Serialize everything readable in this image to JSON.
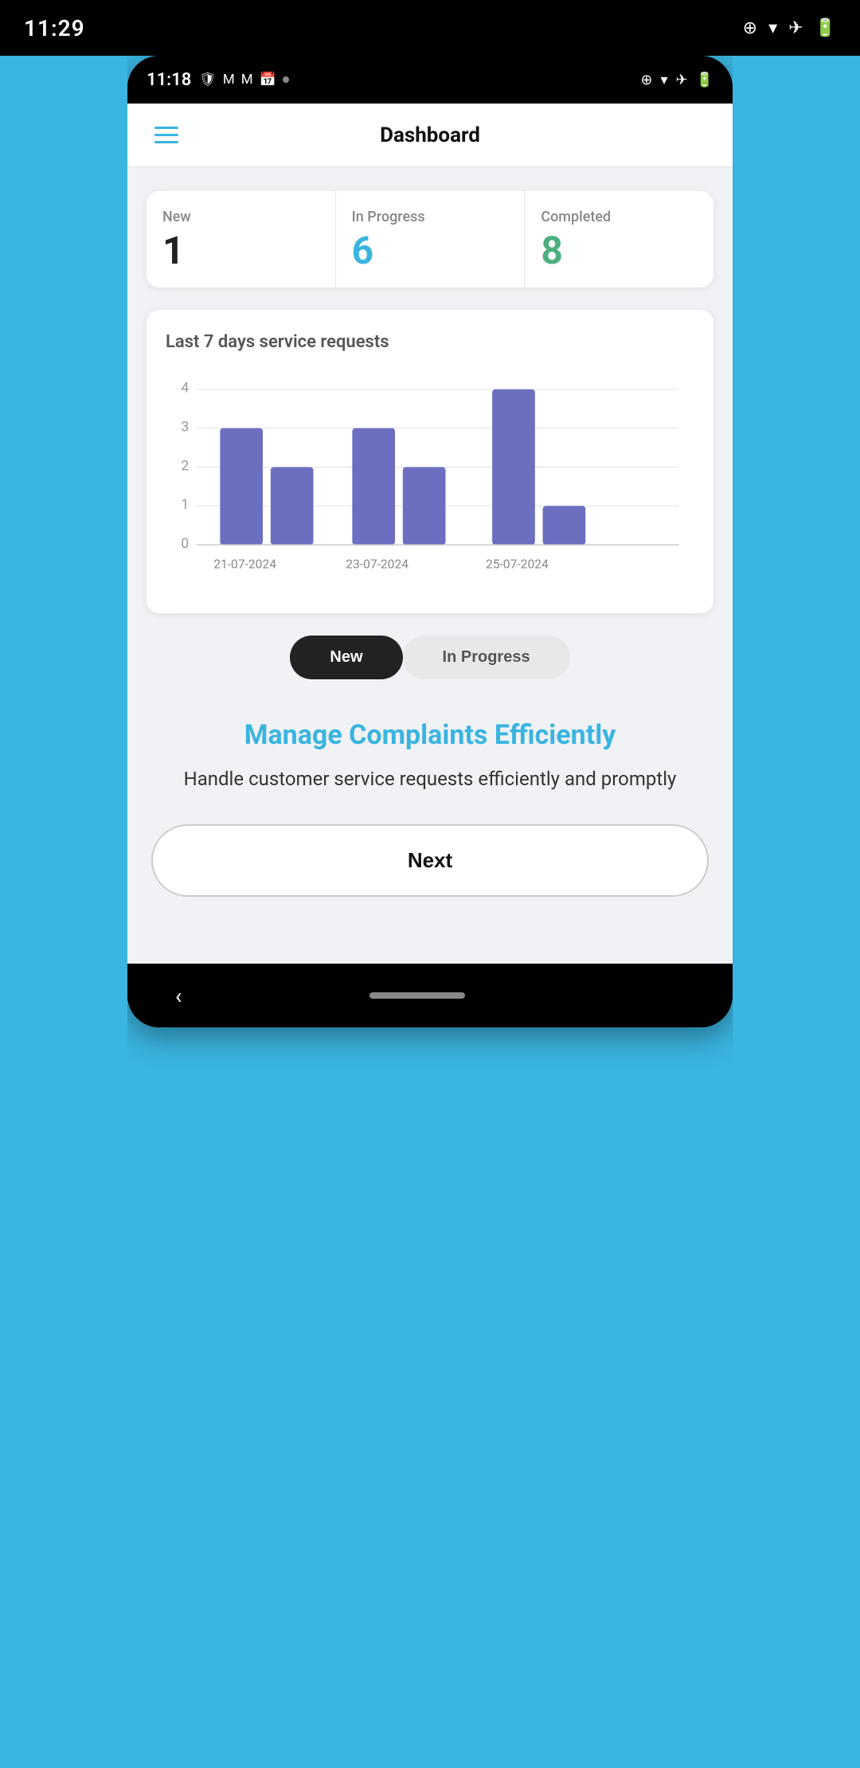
{
  "outer_status": {
    "time": "11:29",
    "icons": [
      "⊕",
      "▼",
      "✈",
      "🔋"
    ]
  },
  "inner_status": {
    "time": "11:18",
    "icons_left": [
      "🛡",
      "M",
      "M",
      "📅"
    ],
    "icons_right": [
      "⊕",
      "▼",
      "✈",
      "🔋"
    ]
  },
  "header": {
    "title": "Dashboard",
    "menu_label": "menu"
  },
  "stats": [
    {
      "label": "New",
      "value": "1",
      "color": "black"
    },
    {
      "label": "In Progress",
      "value": "6",
      "color": "blue"
    },
    {
      "label": "Completed",
      "value": "8",
      "color": "green"
    }
  ],
  "chart": {
    "title": "Last 7 days service requests",
    "y_labels": [
      "4",
      "3",
      "2",
      "1",
      "0"
    ],
    "x_labels": [
      "21-07-2024",
      "23-07-2024",
      "25-07-2024"
    ],
    "bars": [
      {
        "date": "21-07-2024a",
        "value": 3
      },
      {
        "date": "21-07-2024b",
        "value": 2
      },
      {
        "date": "23-07-2024a",
        "value": 3
      },
      {
        "date": "23-07-2024b",
        "value": 2
      },
      {
        "date": "25-07-2024a",
        "value": 4
      },
      {
        "date": "25-07-2024b",
        "value": 1
      }
    ],
    "max_value": 4
  },
  "filter_tabs": [
    {
      "label": "New",
      "active": true
    },
    {
      "label": "In Progress",
      "active": false
    }
  ],
  "promo": {
    "title": "Manage Complaints Efficiently",
    "subtitle": "Handle customer service requests efficiently and promptly"
  },
  "next_button": {
    "label": "Next"
  },
  "bottom_nav": {
    "back_icon": "‹"
  }
}
